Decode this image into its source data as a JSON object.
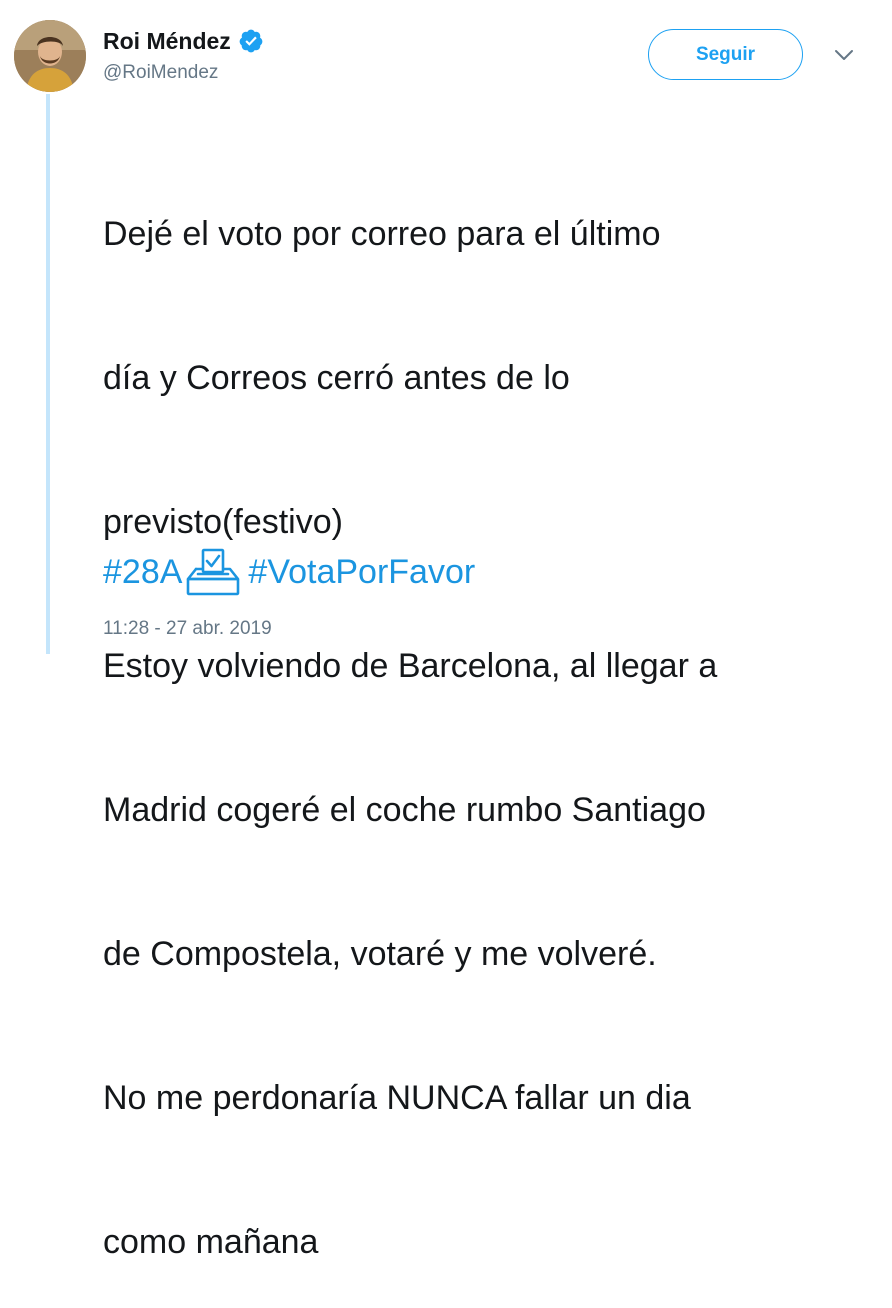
{
  "user": {
    "display_name": "Roi Méndez",
    "handle": "@RoiMendez",
    "verified": true
  },
  "follow_button": {
    "label": "Seguir"
  },
  "tweet": {
    "lines": [
      "Dejé el voto por correo para el último",
      "día y Correos cerró antes de lo",
      "previsto(festivo)",
      "Estoy volviendo de Barcelona, al llegar a",
      "Madrid cogeré el coche rumbo Santiago",
      "de Compostela, votaré y me volveré.",
      "No me perdonaría NUNCA fallar un dia",
      "como mañana"
    ],
    "hashtag_1": "#28A",
    "hashtag_2": "#VotaPorFavor",
    "emoji_icon": "ballot-box-icon"
  },
  "timestamp": "11:28 - 27 abr. 2019",
  "colors": {
    "accent": "#1da1f2",
    "hashtag": "#1b95e0",
    "text": "#14171a",
    "muted": "#657786",
    "thread_line": "#c4e5fb"
  }
}
